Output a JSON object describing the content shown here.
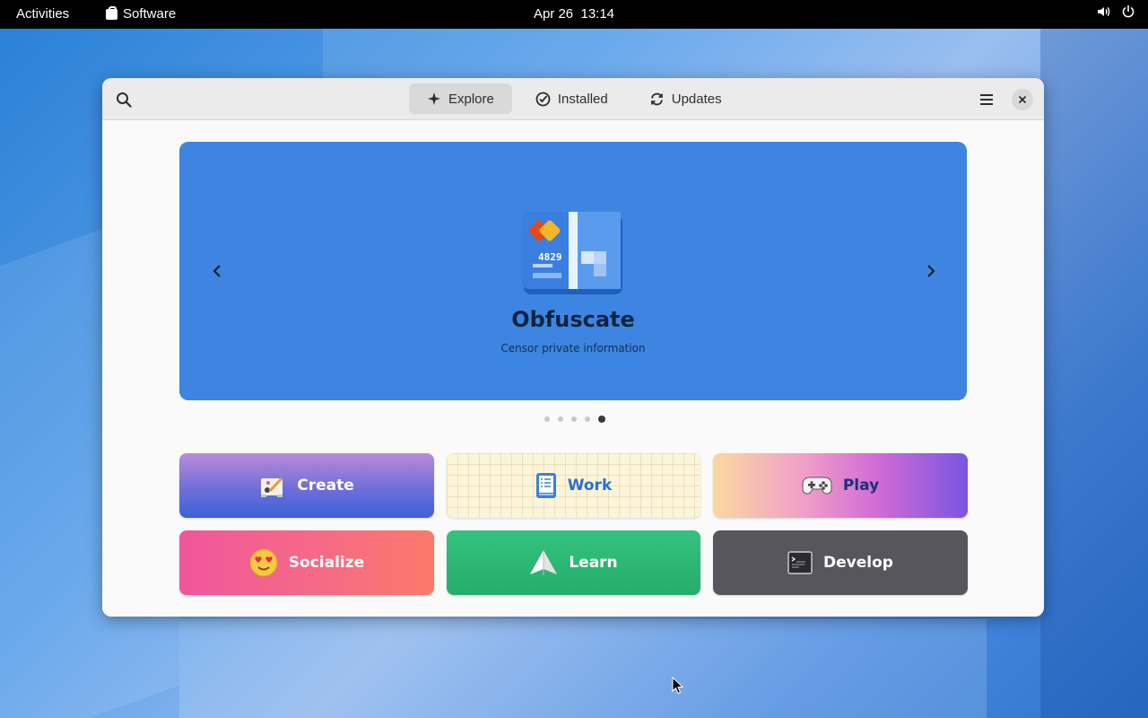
{
  "topbar": {
    "activities": "Activities",
    "app_name": "Software",
    "clock": "Apr 26  13:14",
    "volume_icon": "volume-icon",
    "power_icon": "power-icon"
  },
  "window": {
    "tabs": [
      {
        "label": "Explore",
        "icon": "sparkle-icon",
        "active": true
      },
      {
        "label": "Installed",
        "icon": "check-circle-icon",
        "active": false
      },
      {
        "label": "Updates",
        "icon": "refresh-icon",
        "active": false
      }
    ],
    "search_icon": "search-icon",
    "menu_icon": "hamburger-menu-icon",
    "close_icon": "close-icon"
  },
  "featured": {
    "app_name": "Obfuscate",
    "description": "Censor private information",
    "icon_text": "4829",
    "banner_color": "#3d85e1",
    "current_slide": 5,
    "slide_count": 5
  },
  "categories": [
    {
      "label": "Create",
      "icon": "paint-icon"
    },
    {
      "label": "Work",
      "icon": "checklist-icon"
    },
    {
      "label": "Play",
      "icon": "gamepad-icon"
    },
    {
      "label": "Socialize",
      "icon": "heart-eyes-emoji-icon"
    },
    {
      "label": "Learn",
      "icon": "paper-plane-icon"
    },
    {
      "label": "Develop",
      "icon": "terminal-icon"
    }
  ]
}
